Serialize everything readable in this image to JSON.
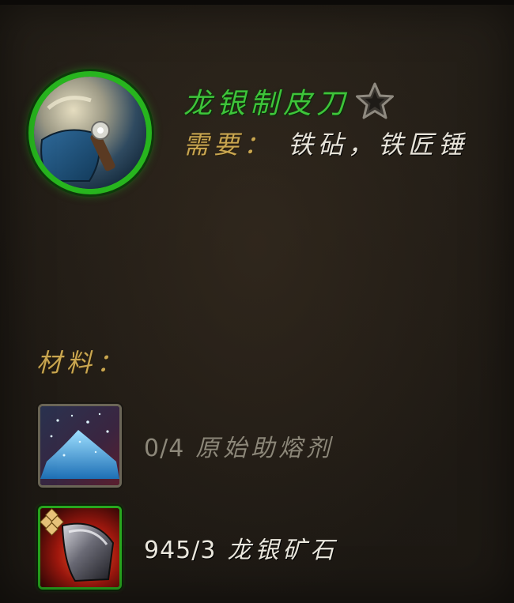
{
  "recipe": {
    "title": "龙银制皮刀",
    "require_label": "需要：",
    "require_value": "铁砧，铁匠锤",
    "icon": "skinning-knife-icon",
    "favorite_icon": "star-outline-icon"
  },
  "materials": {
    "label": "材料：",
    "items": [
      {
        "count": "0/4",
        "name": "原始助熔剂",
        "icon": "primal-flux-icon",
        "have_enough": false
      },
      {
        "count": "945/3",
        "name": "龙银矿石",
        "icon": "dragonsilver-ore-icon",
        "have_enough": true
      }
    ]
  },
  "colors": {
    "title_green": "#3ec43a",
    "label_gold": "#c9a650",
    "text_white": "#ebe8de",
    "text_dim": "#8c8779",
    "border_green": "#28b51e"
  }
}
